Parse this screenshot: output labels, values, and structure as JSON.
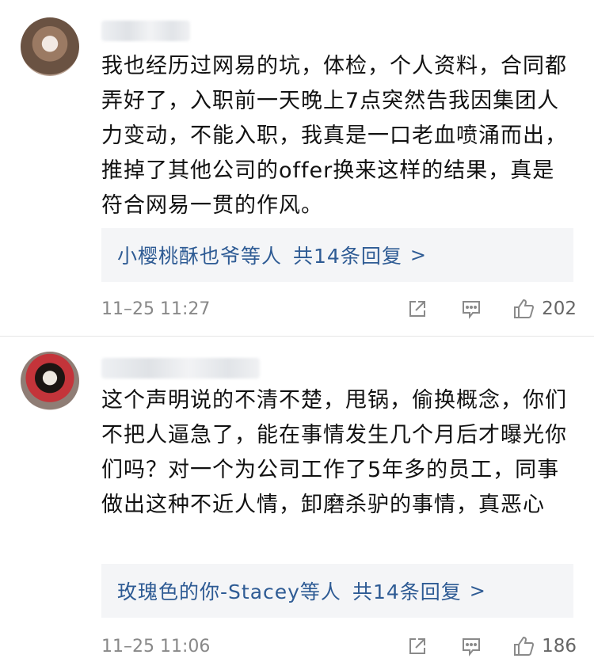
{
  "comments": [
    {
      "text": "我也经历过网易的坑，体检，个人资料，合同都弄好了，入职前一天晚上7点突然告我因集团人力变动，不能入职，我真是一口老血喷涌而出，推掉了其他公司的offer换来这样的结果，真是符合网易一贯的作风。",
      "reply_summary": {
        "who": "小樱桃酥也爷等人",
        "count_label": "共14条回复",
        "chevron": ">"
      },
      "time": "11–25 11:27",
      "likes": "202",
      "icons": [
        "share-icon",
        "reply-icon",
        "like-icon"
      ]
    },
    {
      "text": "这个声明说的不清不楚，甩锅，偷换概念，你们不把人逼急了，能在事情发生几个月后才曝光你们吗？对一个为公司工作了5年多的员工，同事做出这种不近人情，卸磨杀驴的事情，真恶心",
      "reply_summary": {
        "who": "玫瑰色的你-Stacey等人",
        "count_label": "共14条回复",
        "chevron": ">"
      },
      "time": "11–25 11:06",
      "likes": "186",
      "icons": [
        "share-icon",
        "reply-icon",
        "like-icon"
      ]
    }
  ],
  "colors": {
    "link": "#2e5b94",
    "meta": "#888888",
    "reply_bg": "#f4f5f7"
  }
}
